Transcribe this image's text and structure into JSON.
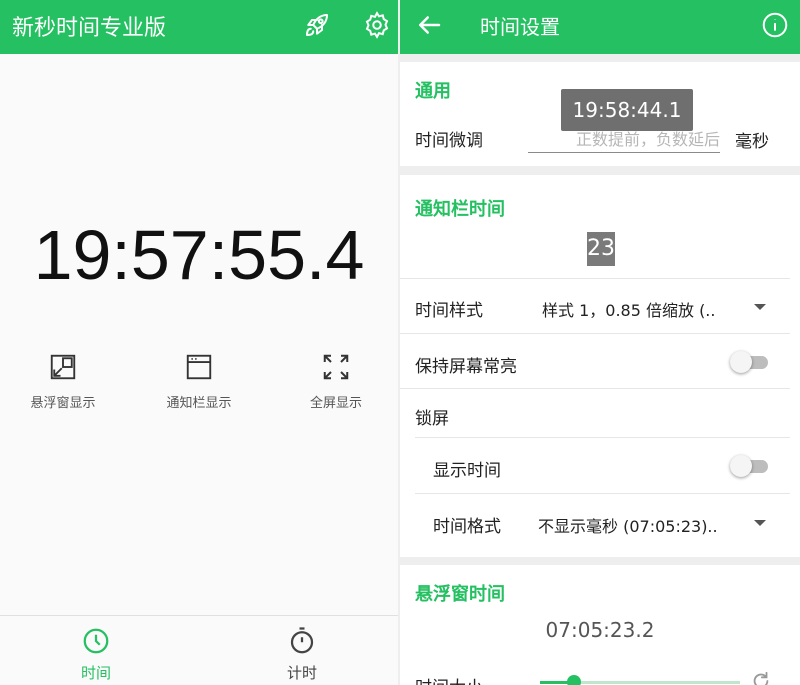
{
  "left_screen": {
    "app_title": "新秒时间专业版",
    "clock": "19:57:55.4",
    "modes": [
      {
        "label": "悬浮窗显示",
        "icon": "floating-window-icon"
      },
      {
        "label": "通知栏显示",
        "icon": "notification-bar-icon"
      },
      {
        "label": "全屏显示",
        "icon": "fullscreen-icon"
      }
    ],
    "bottom_nav": [
      {
        "label": "时间",
        "icon": "clock-icon",
        "selected": true
      },
      {
        "label": "计时",
        "icon": "stopwatch-icon",
        "selected": false
      }
    ],
    "icons": {
      "rocket": "rocket-icon",
      "settings": "gear-icon"
    }
  },
  "right_screen": {
    "title": "时间设置",
    "icons": {
      "back": "back-arrow-icon",
      "info": "info-icon"
    },
    "general": {
      "section_title": "通用",
      "fine_tune_label": "时间微调",
      "fine_tune_placeholder": "正数提前，负数延后",
      "fine_tune_unit": "毫秒",
      "tooltip": "19:58:44.1"
    },
    "notification": {
      "section_title": "通知栏时间",
      "preview": "23",
      "style_label": "时间样式",
      "style_value": "样式 1，0.85 倍缩放 (..",
      "keep_screen_on_label": "保持屏幕常亮",
      "keep_screen_on": false,
      "lock_screen_label": "锁屏",
      "show_time_label": "显示时间",
      "show_time": false,
      "time_format_label": "时间格式",
      "time_format_value": "不显示毫秒 (07:05:23).."
    },
    "floating": {
      "section_title": "悬浮窗时间",
      "preview": "07:05:23.2",
      "size_label": "时间大小",
      "size_level": 0.17
    }
  },
  "colors": {
    "accent": "#24c061",
    "background": "#eeeeee",
    "tooltip": "#6f6f6f"
  }
}
